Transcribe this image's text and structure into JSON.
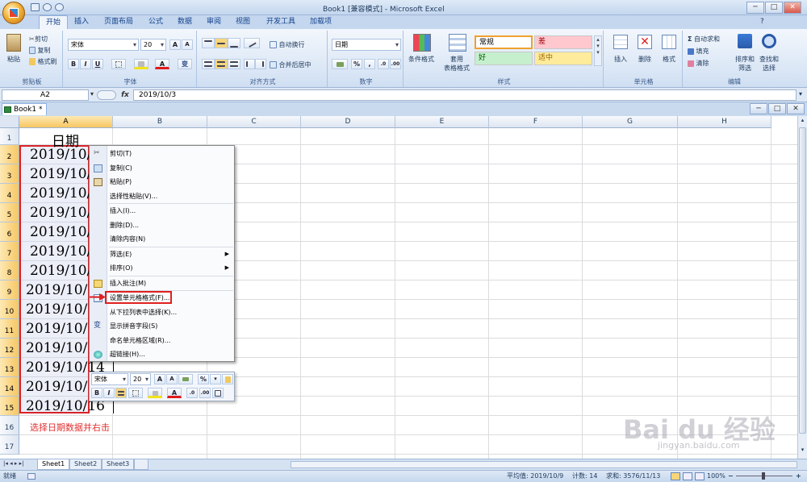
{
  "window": {
    "title": "Book1 [兼容模式] - Microsoft Excel",
    "min": "─",
    "max": "□",
    "close": "✕"
  },
  "tabs": [
    "开始",
    "插入",
    "页面布局",
    "公式",
    "数据",
    "审阅",
    "视图",
    "开发工具",
    "加载项"
  ],
  "ribbon": {
    "clipboard": {
      "label": "剪贴板",
      "paste": "粘贴",
      "cut": "剪切",
      "copy": "复制",
      "format_painter": "格式刷"
    },
    "font": {
      "label": "字体",
      "name": "宋体",
      "size": "20",
      "bold": "B",
      "italic": "I",
      "underline": "U",
      "grow": "A",
      "shrink": "A",
      "font_color": "A",
      "phonetic": "变"
    },
    "alignment": {
      "label": "对齐方式",
      "wrap": "自动换行",
      "merge": "合并后居中"
    },
    "number": {
      "label": "数字",
      "format": "日期",
      "percent": "%",
      "comma": ","
    },
    "styles": {
      "label": "样式",
      "conditional": "条件格式",
      "table": "套用\n表格格式",
      "normal": "常规",
      "bad": "差",
      "good": "好",
      "neutral": "适中"
    },
    "cells": {
      "label": "单元格",
      "insert": "插入",
      "delete": "删除",
      "format": "格式"
    },
    "editing": {
      "label": "编辑",
      "autosum": "自动求和",
      "fill": "填充",
      "clear": "清除",
      "sort": "排序和\n筛选",
      "find": "查找和\n选择"
    }
  },
  "formula_bar": {
    "name_box": "A2",
    "fx": "fx",
    "content": "2019/10/3"
  },
  "workbook_tab": "Book1 *",
  "columns": [
    "A",
    "B",
    "C",
    "D",
    "E",
    "F",
    "G",
    "H"
  ],
  "rows": [
    "1",
    "2",
    "3",
    "4",
    "5",
    "6",
    "7",
    "8",
    "9",
    "10",
    "11",
    "12",
    "13",
    "14",
    "15",
    "16",
    "17"
  ],
  "cells": {
    "a1": "日期",
    "a2": "2019/10/",
    "a3": "2019/10/",
    "a4": "2019/10/",
    "a5": "2019/10/",
    "a6": "2019/10/",
    "a7": "2019/10/",
    "a8": "2019/10/",
    "a9": "2019/10/",
    "a10": "2019/10/",
    "a11": "2019/10/",
    "a12": "2019/10/",
    "a13": "2019/10/14",
    "a14": "2019/10/",
    "a15": "2019/10/16"
  },
  "context_menu": [
    "剪切(T)",
    "复制(C)",
    "粘贴(P)",
    "选择性粘贴(V)...",
    "插入(I)...",
    "删除(D)...",
    "清除内容(N)",
    "筛选(E)",
    "排序(O)",
    "插入批注(M)",
    "设置单元格格式(F)...",
    "从下拉列表中选择(K)...",
    "显示拼音字段(S)",
    "命名单元格区域(R)...",
    "超链接(H)..."
  ],
  "mini_toolbar": {
    "font": "宋体",
    "size": "20",
    "grow": "A",
    "shrink": "A",
    "percent": "%",
    "bold": "B",
    "italic": "I",
    "font_color": "A"
  },
  "sheets": [
    "Sheet1",
    "Sheet2",
    "Sheet3"
  ],
  "status": {
    "ready": "就绪",
    "average": "平均值: 2019/10/9",
    "count": "计数: 14",
    "sum": "求和: 3576/11/13",
    "zoom": "100%"
  },
  "annotation": "选择日期数据并右击",
  "watermark": "Bai du 经验",
  "watermark_url": "jingyan.baidu.com",
  "colors": {
    "highlight": "#e02020",
    "selection_border": "#d8232a",
    "ribbon_bg": "#dbe7f6"
  }
}
